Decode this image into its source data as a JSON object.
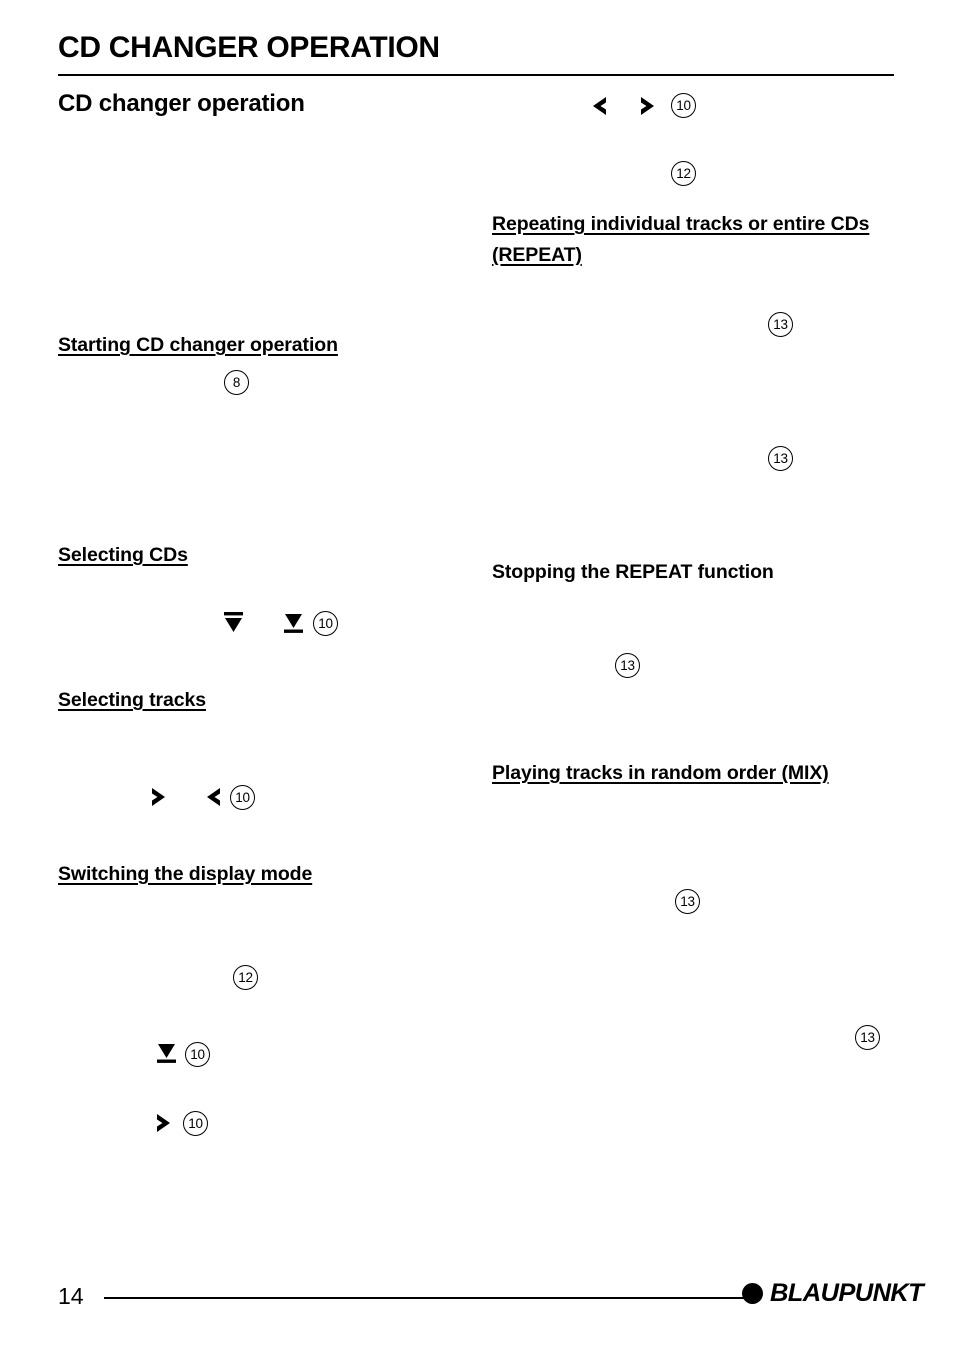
{
  "document": {
    "running_head": "CD CHANGER OPERATION",
    "section_title": "CD changer operation",
    "page_number": "14",
    "brand": "BLAUPUNKT"
  },
  "left_column": {
    "headings": [
      {
        "id": "starting-cd-changer-operation",
        "text": "Starting CD changer operation",
        "underlined": true
      },
      {
        "id": "selecting-cds",
        "text": "Selecting CDs",
        "underlined": true
      },
      {
        "id": "selecting-tracks",
        "text": "Selecting tracks",
        "underlined": true
      },
      {
        "id": "switching-the-display-mode",
        "text": "Switching the display mode",
        "underlined": true
      }
    ],
    "refs": [
      {
        "id": "ref-8-starting",
        "value": "8"
      },
      {
        "id": "ref-10-selecting-cds",
        "value": "10"
      },
      {
        "id": "ref-10-selecting-tracks",
        "value": "10"
      },
      {
        "id": "ref-12-display-mode",
        "value": "12"
      },
      {
        "id": "ref-10-display-down",
        "value": "10"
      },
      {
        "id": "ref-10-display-right",
        "value": "10"
      }
    ],
    "glyphs": [
      {
        "id": "seek-up-bar",
        "icon": "arrow-up-bar-icon"
      },
      {
        "id": "seek-down-bar",
        "icon": "arrow-down-bar-icon"
      },
      {
        "id": "track-forward",
        "icon": "arrow-right-icon"
      },
      {
        "id": "track-back",
        "icon": "arrow-left-icon"
      },
      {
        "id": "display-down",
        "icon": "arrow-down-bar-icon"
      },
      {
        "id": "display-right",
        "icon": "arrow-right-icon"
      }
    ]
  },
  "right_column": {
    "headings": [
      {
        "id": "repeating-tracks-or-cds",
        "text": "Repeating individual tracks or entire CDs (REPEAT)",
        "underlined": true
      },
      {
        "id": "stopping-the-repeat-function",
        "text": "Stopping the REPEAT function",
        "underlined": false
      },
      {
        "id": "playing-tracks-in-random-order",
        "text": "Playing tracks in random order (MIX)",
        "underlined": true
      }
    ],
    "refs": [
      {
        "id": "ref-10-top",
        "value": "10"
      },
      {
        "id": "ref-12-top",
        "value": "12"
      },
      {
        "id": "ref-13-repeat-a",
        "value": "13"
      },
      {
        "id": "ref-13-repeat-b",
        "value": "13"
      },
      {
        "id": "ref-13-stop-repeat",
        "value": "13"
      },
      {
        "id": "ref-13-mix-a",
        "value": "13"
      },
      {
        "id": "ref-13-mix-b",
        "value": "13"
      }
    ],
    "glyphs": [
      {
        "id": "top-left-arrow",
        "icon": "arrow-left-icon"
      },
      {
        "id": "top-right-arrow",
        "icon": "arrow-right-icon"
      }
    ]
  }
}
